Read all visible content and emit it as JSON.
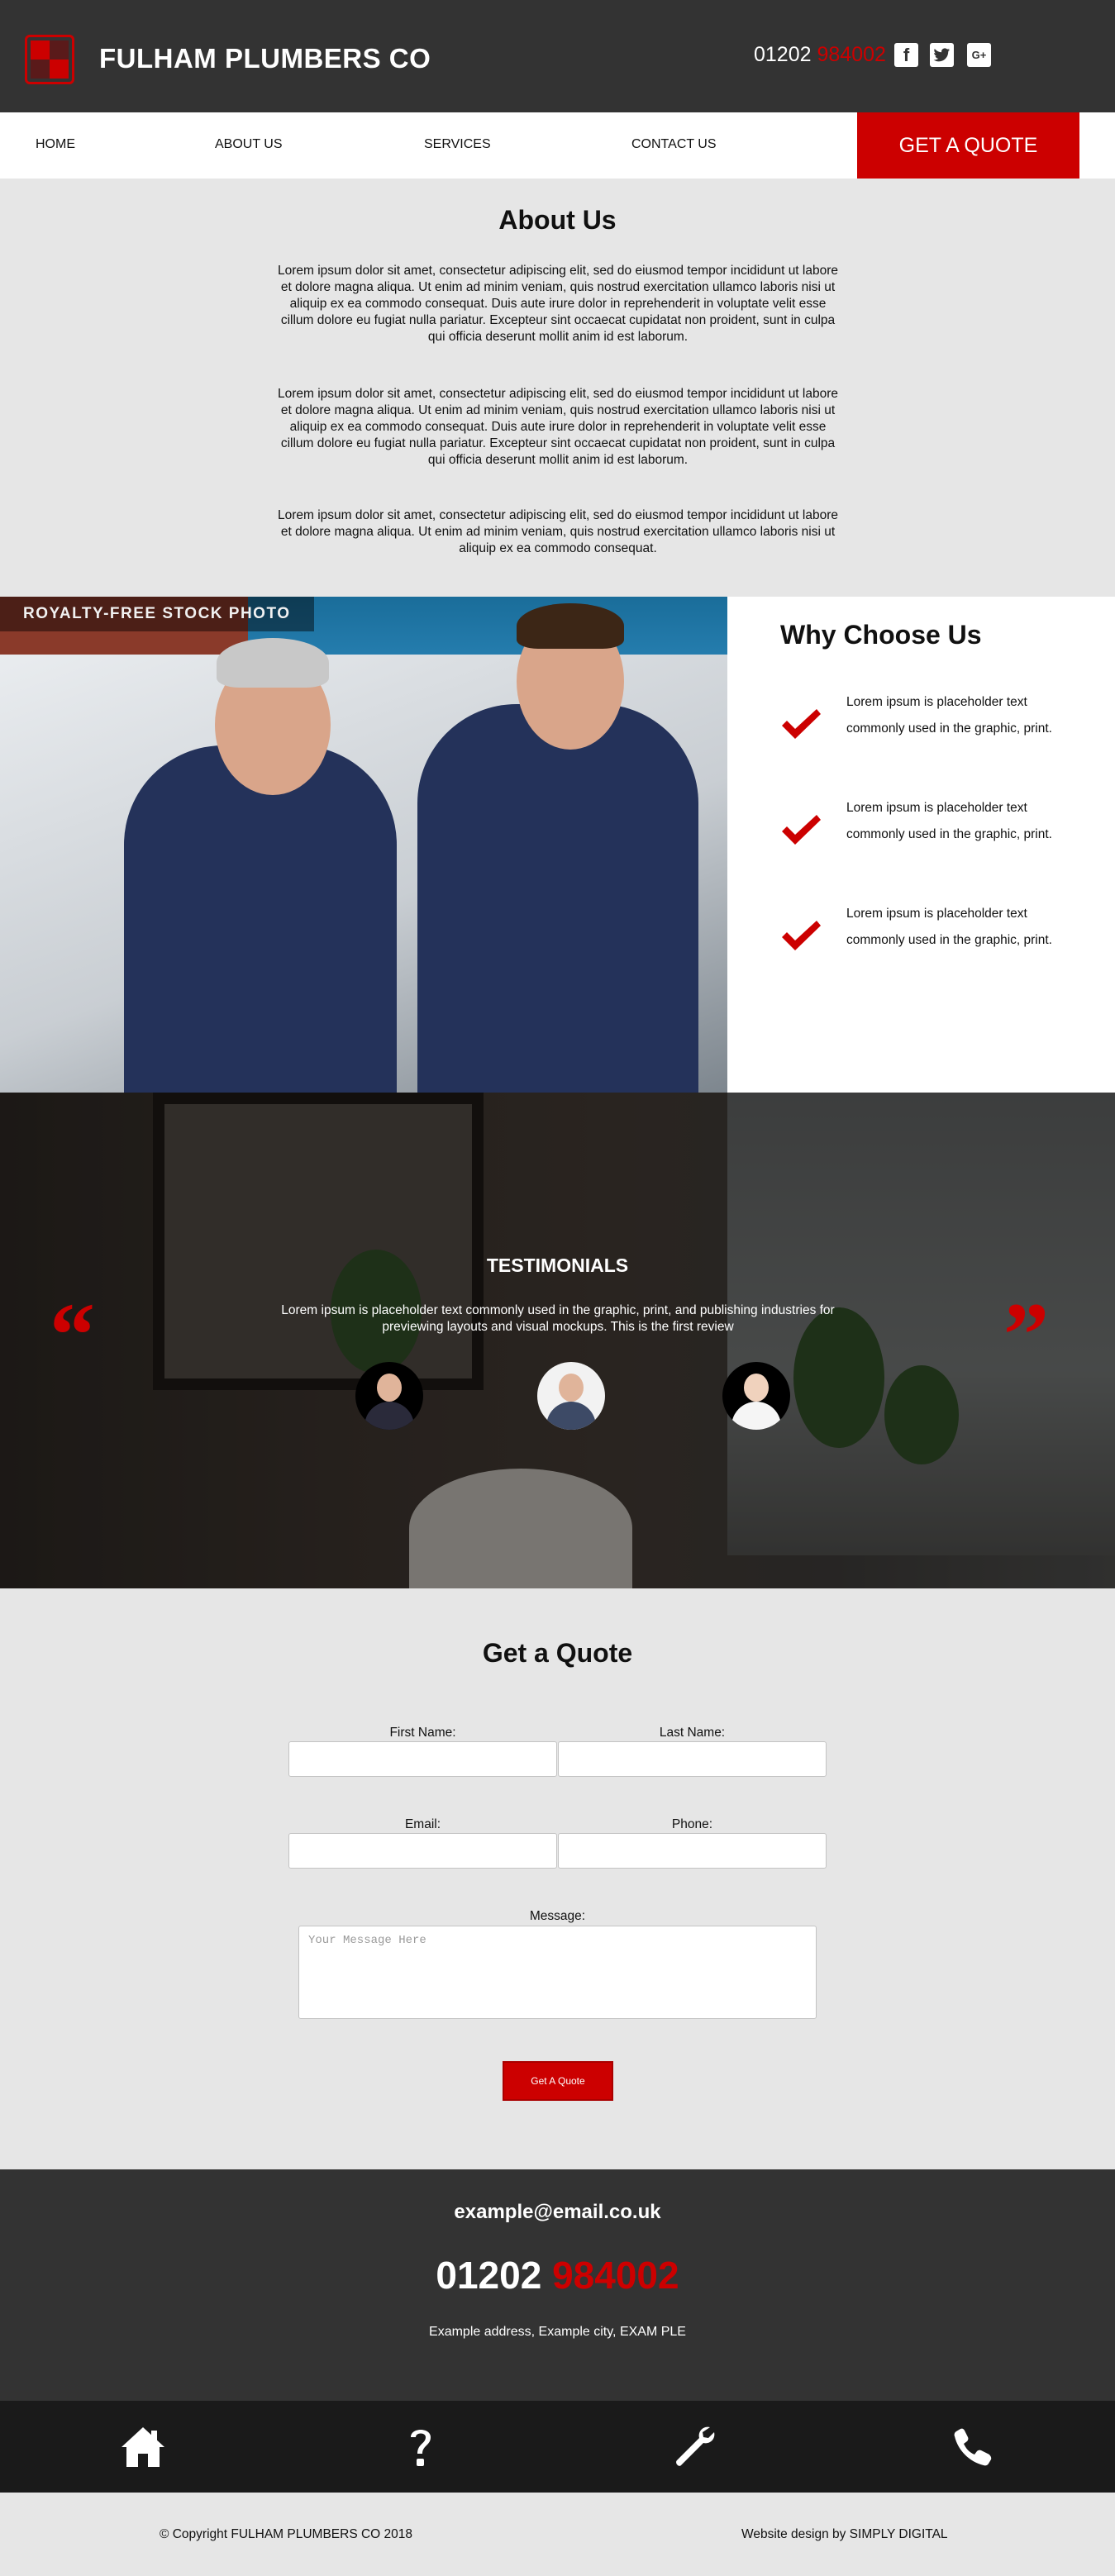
{
  "header": {
    "brand": "FULHAM PLUMBERS CO",
    "phone_prefix": "01202",
    "phone_suffix": "984002",
    "social": [
      "facebook-icon",
      "twitter-icon",
      "google-plus-icon"
    ],
    "gplus_label": "G+"
  },
  "nav": {
    "items": [
      {
        "label": "HOME"
      },
      {
        "label": "ABOUT US"
      },
      {
        "label": "SERVICES"
      },
      {
        "label": "CONTACT US"
      }
    ],
    "cta": "GET A QUOTE"
  },
  "about": {
    "title": "About Us",
    "paragraphs": [
      "Lorem ipsum dolor sit amet, consectetur adipiscing elit, sed do eiusmod tempor incididunt ut labore et dolore magna aliqua. Ut enim ad minim veniam, quis nostrud exercitation ullamco laboris nisi ut aliquip ex ea commodo consequat. Duis aute irure dolor in reprehenderit in voluptate velit esse cillum dolore eu fugiat nulla pariatur. Excepteur sint occaecat cupidatat non proident, sunt in culpa qui officia deserunt mollit anim id est laborum.",
      "Lorem ipsum dolor sit amet, consectetur adipiscing elit, sed do eiusmod tempor incididunt ut labore et dolore magna aliqua. Ut enim ad minim veniam, quis nostrud exercitation ullamco laboris nisi ut aliquip ex ea commodo consequat. Duis aute irure dolor in reprehenderit in voluptate velit esse cillum dolore eu fugiat nulla pariatur. Excepteur sint occaecat cupidatat non proident, sunt in culpa qui officia deserunt mollit anim id est laborum.",
      "Lorem ipsum dolor sit amet, consectetur adipiscing elit, sed do eiusmod tempor incididunt ut labore et dolore magna aliqua. Ut enim ad minim veniam, quis nostrud exercitation ullamco laboris nisi ut aliquip ex ea commodo consequat."
    ]
  },
  "photo": {
    "watermark": "ROYALTY-FREE STOCK PHOTO"
  },
  "why": {
    "title": "Why Choose Us",
    "items": [
      "Lorem ipsum is placeholder text commonly used in the graphic, print.",
      "Lorem ipsum is placeholder text commonly used in the graphic, print.",
      "Lorem ipsum is placeholder text commonly used in the graphic, print."
    ]
  },
  "testimonials": {
    "title": "TESTIMONIALS",
    "text": "Lorem ipsum is placeholder text commonly used in the graphic, print, and publishing industries for previewing layouts and visual mockups. This is the first review",
    "open_quote": "“",
    "close_quote": "”"
  },
  "quote_form": {
    "title": "Get a Quote",
    "first_name_label": "First Name:",
    "last_name_label": "Last Name:",
    "email_label": "Email:",
    "phone_label": "Phone:",
    "message_label": "Message:",
    "message_placeholder": "Your Message Here",
    "submit_label": "Get A Quote"
  },
  "contact": {
    "email": "example@email.co.uk",
    "phone_prefix": "01202",
    "phone_suffix": "984002",
    "address": "Example address, Example city, EXAM PLE"
  },
  "icon_bar": [
    "home-icon",
    "question-icon",
    "wrench-icon",
    "phone-icon"
  ],
  "copyright": {
    "left": "© Copyright FULHAM PLUMBERS CO 2018",
    "right": "Website design by SIMPLY DIGITAL"
  },
  "colors": {
    "accent": "#cc0000",
    "dark": "#333333",
    "darker": "#1a1a1a",
    "light_bg": "#e6e6e6"
  }
}
